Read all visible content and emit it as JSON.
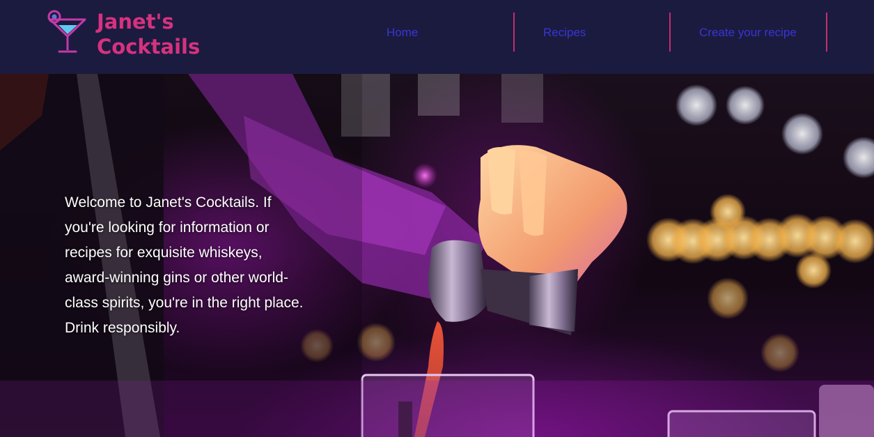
{
  "brand": {
    "line1": "Janet's",
    "line2": "Cocktails",
    "color": "#d6327f",
    "logo_icon": "cocktail-glass-icon"
  },
  "nav": {
    "home": "Home",
    "recipes": "Recipes",
    "create": "Create your recipe",
    "link_color": "#3a34d6",
    "separator_color": "#c52d6f",
    "background": "#1b1b3f"
  },
  "hero": {
    "text": "Welcome to Janet's Cocktails. If you're looking for information or recipes for exquisite whiskeys, award-winning gins or other world-class spirits, you're in the right place. Drink responsibly."
  }
}
